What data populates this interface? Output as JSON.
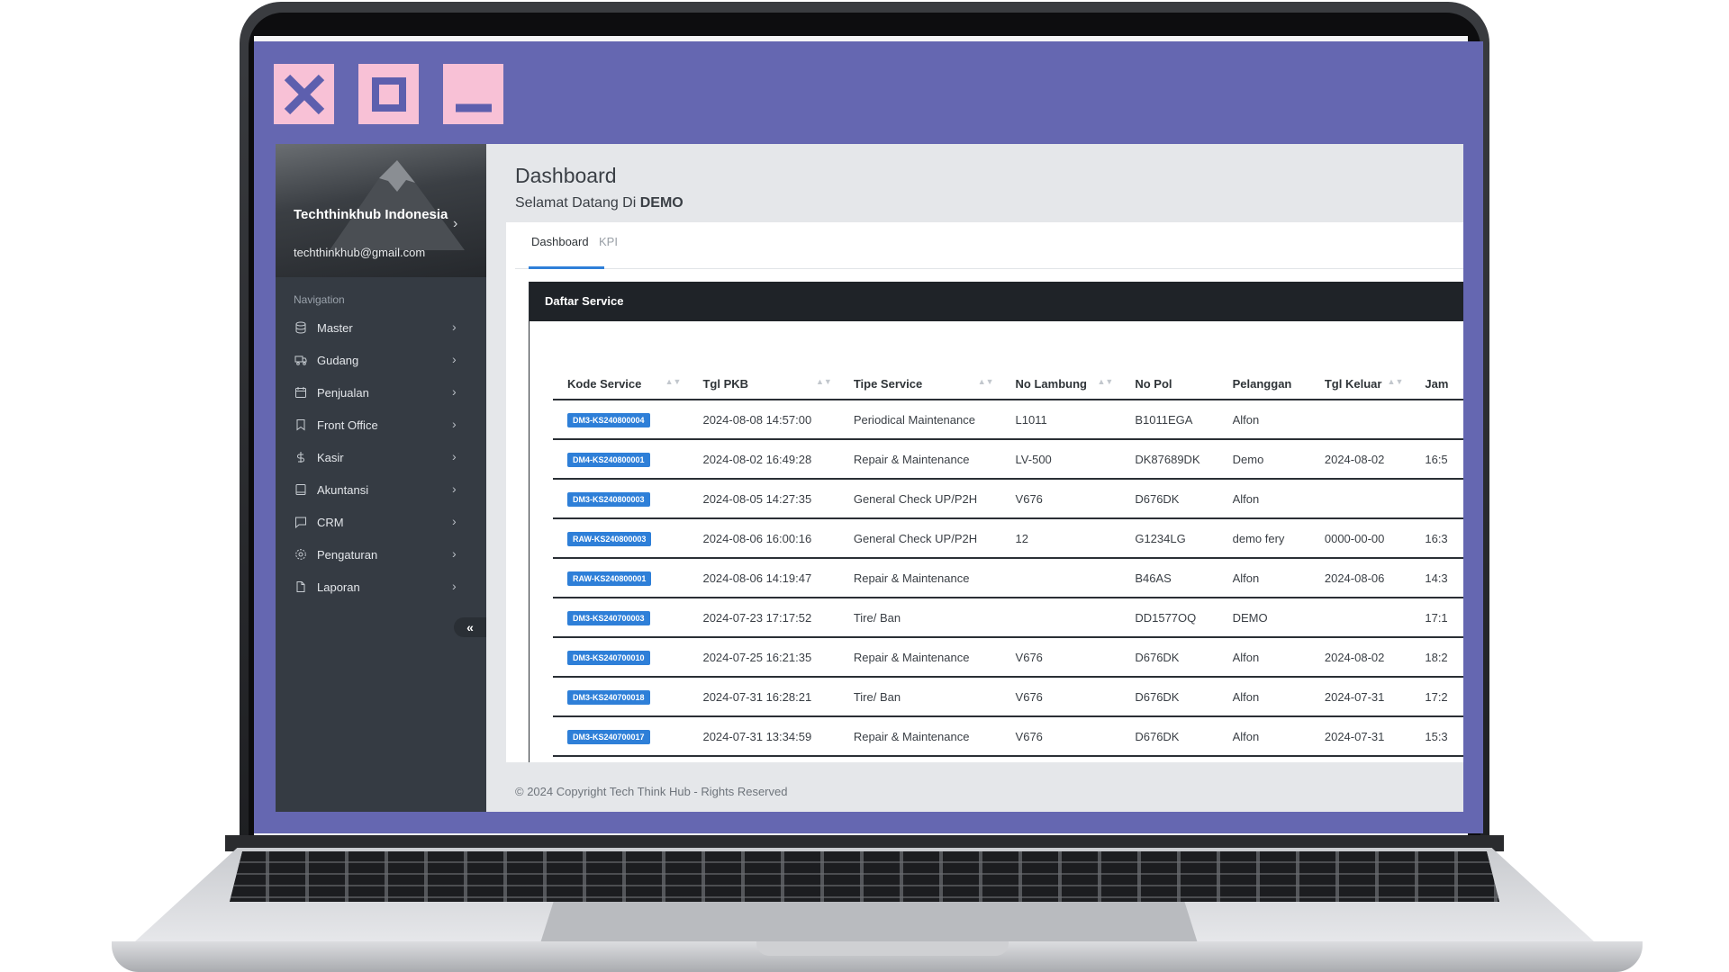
{
  "window_controls": {
    "close_icon": "close-icon",
    "maximize_icon": "maximize-icon",
    "minimize_icon": "minimize-icon"
  },
  "profile": {
    "name": "Techthinkhub Indonesia",
    "email": "techthinkhub@gmail.com"
  },
  "sidebar": {
    "nav_label": "Navigation",
    "items": [
      {
        "label": "Master",
        "icon": "database-icon"
      },
      {
        "label": "Gudang",
        "icon": "truck-icon"
      },
      {
        "label": "Penjualan",
        "icon": "calendar-icon"
      },
      {
        "label": "Front Office",
        "icon": "bookmark-icon"
      },
      {
        "label": "Kasir",
        "icon": "dollar-icon"
      },
      {
        "label": "Akuntansi",
        "icon": "book-icon"
      },
      {
        "label": "CRM",
        "icon": "message-icon"
      },
      {
        "label": "Pengaturan",
        "icon": "settings-icon"
      },
      {
        "label": "Laporan",
        "icon": "file-icon"
      }
    ],
    "collapse_icon": "«"
  },
  "header": {
    "title": "Dashboard",
    "welcome_prefix": "Selamat Datang Di",
    "welcome_name": "DEMO"
  },
  "tabs": [
    {
      "label": "Dashboard",
      "active": true
    },
    {
      "label": "KPI",
      "active": false
    }
  ],
  "panel": {
    "title": "Daftar Service"
  },
  "table": {
    "columns": [
      "Kode Service",
      "Tgl PKB",
      "Tipe Service",
      "No Lambung",
      "No Pol",
      "Pelanggan",
      "Tgl Keluar",
      "Jam"
    ],
    "rows": [
      [
        "DM3-KS240800004",
        "2024-08-08 14:57:00",
        "Periodical Maintenance",
        "L1011",
        "B1011EGA",
        "Alfon",
        "",
        ""
      ],
      [
        "DM4-KS240800001",
        "2024-08-02 16:49:28",
        "Repair & Maintenance",
        "LV-500",
        "DK87689DK",
        "Demo",
        "2024-08-02",
        "16:5"
      ],
      [
        "DM3-KS240800003",
        "2024-08-05 14:27:35",
        "General Check UP/P2H",
        "V676",
        "D676DK",
        "Alfon",
        "",
        ""
      ],
      [
        "RAW-KS240800003",
        "2024-08-06 16:00:16",
        "General Check UP/P2H",
        "12",
        "G1234LG",
        "demo fery",
        "0000-00-00",
        "16:3"
      ],
      [
        "RAW-KS240800001",
        "2024-08-06 14:19:47",
        "Repair & Maintenance",
        "",
        "B46AS",
        "Alfon",
        "2024-08-06",
        "14:3"
      ],
      [
        "DM3-KS240700003",
        "2024-07-23 17:17:52",
        "Tire/ Ban",
        "",
        "DD1577OQ",
        "DEMO",
        "",
        "17:1"
      ],
      [
        "DM3-KS240700010",
        "2024-07-25 16:21:35",
        "Repair & Maintenance",
        "V676",
        "D676DK",
        "Alfon",
        "2024-08-02",
        "18:2"
      ],
      [
        "DM3-KS240700018",
        "2024-07-31 16:28:21",
        "Tire/ Ban",
        "V676",
        "D676DK",
        "Alfon",
        "2024-07-31",
        "17:2"
      ],
      [
        "DM3-KS240700017",
        "2024-07-31 13:34:59",
        "Repair & Maintenance",
        "V676",
        "D676DK",
        "Alfon",
        "2024-07-31",
        "15:3"
      ]
    ]
  },
  "footer": {
    "text": "© 2024 Copyright Tech Think Hub - Rights Reserved"
  },
  "colors": {
    "frame": "#6567b1",
    "window_button": "#f8c1d6",
    "sidebar": "#353b43",
    "badge": "#2e7fd8",
    "panel_header": "#1f2328"
  }
}
